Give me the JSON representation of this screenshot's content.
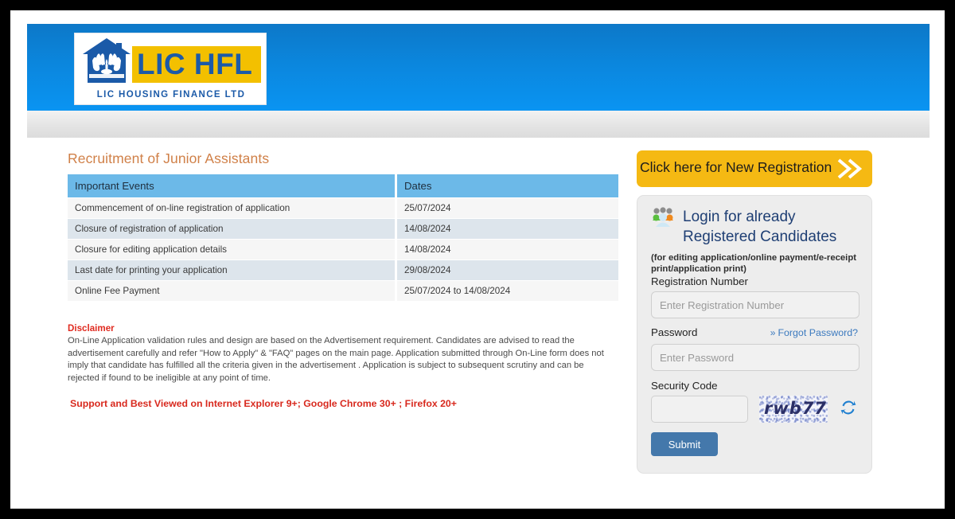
{
  "header": {
    "logo": {
      "brand": "LIC HFL",
      "subtitle": "LIC HOUSING FINANCE LTD",
      "house_icon": "house-with-hands-icon",
      "brand_color": "#1b5aa8",
      "band_color": "#f3c000"
    },
    "banner_color_top": "#0d78c8",
    "banner_color_bottom": "#0a94f2"
  },
  "main": {
    "title": "Recruitment of Junior Assistants",
    "title_color": "#d08048",
    "table": {
      "columns": [
        "Important Events",
        "Dates"
      ],
      "header_color": "#6cb9e8",
      "rows": [
        [
          "Commencement of on-line registration of application",
          "25/07/2024"
        ],
        [
          "Closure of registration of application",
          "14/08/2024"
        ],
        [
          "Closure for editing application details",
          "14/08/2024"
        ],
        [
          "Last date for printing your application",
          "29/08/2024"
        ],
        [
          "Online Fee Payment",
          "25/07/2024 to 14/08/2024"
        ]
      ]
    },
    "disclaimer": {
      "title": "Disclaimer",
      "title_color": "#e02b20",
      "body": "On-Line Application validation rules and design are based on the Advertisement requirement. Candidates are advised to read the advertisement carefully and refer \"How to Apply\" & \"FAQ\" pages on the main page. Application submitted through On-Line form does not imply that candidate has fulfilled all the criteria given in the advertisement . Application is subject to subsequent scrutiny and can be rejected if found to be ineligible at any point of time."
    },
    "support_line": "Support and Best Viewed on Internet Explorer 9+; Google Chrome 30+ ; Firefox 20+",
    "support_color": "#d8291e"
  },
  "login": {
    "new_registration": {
      "label": "Click here for New Registration",
      "chevron": "double-chevron-right-icon",
      "bg_color": "#f5b913"
    },
    "panel": {
      "icon": "users-group-icon",
      "heading_line1": "Login for already",
      "heading_line2": "Registered Candidates",
      "heading_color": "#1f3f74",
      "note": "(for editing application/online payment/e-receipt print/application print)",
      "registration_label": "Registration Number",
      "registration_value": "",
      "registration_placeholder": "Enter Registration Number",
      "password_label": "Password",
      "password_value": "",
      "password_placeholder": "Enter Password",
      "forgot_password": "Forgot Password?",
      "forgot_password_chevron": "double-chevron-right-icon",
      "forgot_password_color": "#3c7abf",
      "security_code_label": "Security Code",
      "security_code_value": "",
      "captcha_text": "rwb77",
      "captcha_refresh_icon": "refresh-icon",
      "submit_label": "Submit",
      "submit_color": "#4478ab"
    }
  }
}
